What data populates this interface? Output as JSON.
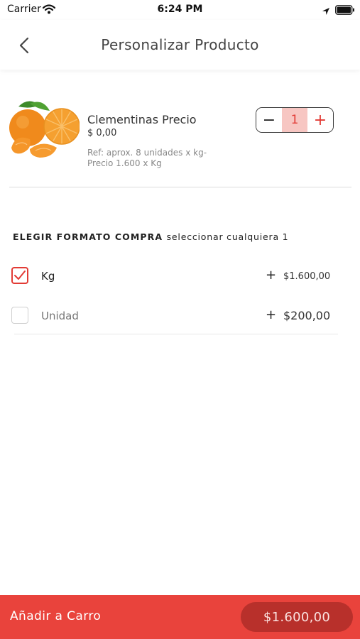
{
  "status_bar": {
    "carrier": "Carrier",
    "time": "6:24 PM",
    "icons": [
      "wifi-icon",
      "location-icon",
      "battery-icon"
    ]
  },
  "nav": {
    "title": "Personalizar Producto",
    "back_icon": "chevron-left-icon"
  },
  "product": {
    "name": "Clementinas Precio",
    "price": "$ 0,00",
    "ref": "Ref: aprox. 8 unidades x kg- Precio 1.600 x Kg",
    "image_icon": "clementine-image",
    "quantity": "1",
    "minus_label": "−",
    "plus_label": "+"
  },
  "options_section": {
    "title": "ELEGIR FORMATO COMPRA",
    "subtitle": "seleccionar cualquiera 1",
    "items": [
      {
        "label": "Kg",
        "plus": "+",
        "price": "$1.600,00",
        "checked": true
      },
      {
        "label": "Unidad",
        "plus": "+",
        "price": "$200,00",
        "checked": false
      }
    ]
  },
  "bottom_bar": {
    "add_label": "Añadir a Carro",
    "total": "$1.600,00"
  },
  "colors": {
    "accent": "#e9433c",
    "accent_dark": "#b8302b",
    "stepper_fill": "#f7c6c2"
  }
}
